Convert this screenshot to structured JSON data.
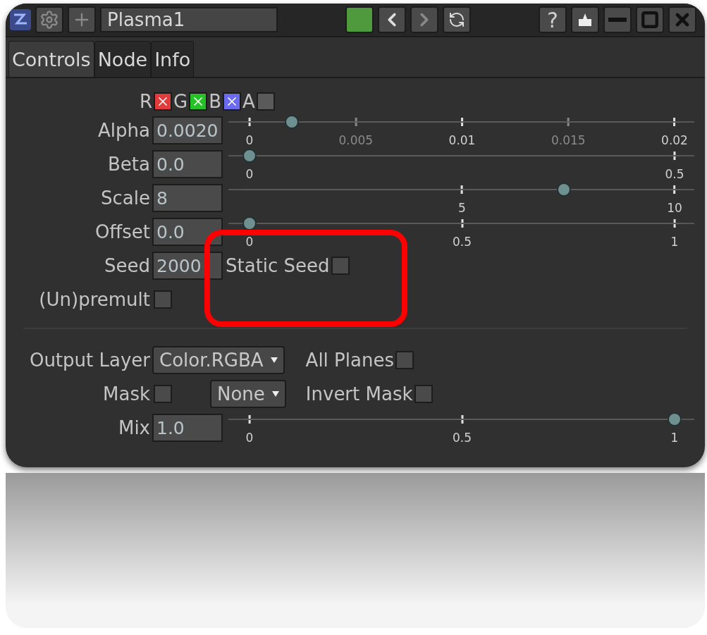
{
  "title_bar": {
    "node_name": "Plasma1",
    "help": "?"
  },
  "tabs": [
    {
      "label": "Controls",
      "selected": true
    },
    {
      "label": "Node",
      "selected": false
    },
    {
      "label": "Info",
      "selected": false
    }
  ],
  "channels": [
    {
      "label": "R",
      "checked": true,
      "color": "#e23b3b"
    },
    {
      "label": "G",
      "checked": true,
      "color": "#26c126"
    },
    {
      "label": "B",
      "checked": true,
      "color": "#6b6bf0"
    },
    {
      "label": "A",
      "checked": false,
      "color": "#5a5a5a"
    }
  ],
  "params": [
    {
      "kind": "slider",
      "label": "Alpha",
      "value": "0.0020",
      "level": 0.1,
      "ticks": [
        {
          "label": "0",
          "major": true
        },
        {
          "label": "0.005",
          "major": false
        },
        {
          "label": "0.01",
          "major": true
        },
        {
          "label": "0.015",
          "major": false
        },
        {
          "label": "0.02",
          "major": true
        }
      ]
    },
    {
      "kind": "slider",
      "label": "Beta",
      "value": "0.0",
      "level": 0,
      "ticks": [
        {
          "label": "0",
          "major": true
        },
        {
          "label": "0.5",
          "major": true
        }
      ]
    },
    {
      "kind": "slider",
      "label": "Scale",
      "value": "8",
      "level": 0.74,
      "ticks": [
        {
          "label": "5",
          "major": true
        },
        {
          "label": "10",
          "major": true
        }
      ]
    },
    {
      "kind": "slider",
      "label": "Offset",
      "value": "0.0",
      "level": 0,
      "ticks": [
        {
          "label": "0",
          "major": true
        },
        {
          "label": "0.5",
          "major": true
        },
        {
          "label": "1",
          "major": true
        }
      ]
    },
    {
      "kind": "seed",
      "label": "Seed",
      "value": "2000",
      "option": {
        "label": "Static Seed",
        "checked": false
      }
    },
    {
      "kind": "check",
      "label": "(Un)premult",
      "checked": false
    }
  ],
  "output": [
    {
      "kind": "layer",
      "label": "Output Layer",
      "dropdown": "Color.RGBA",
      "option": {
        "label": "All Planes",
        "checked": false
      }
    },
    {
      "kind": "mask",
      "label": "Mask",
      "checked": false,
      "dropdown": "None",
      "option": {
        "label": "Invert Mask",
        "checked": false
      }
    },
    {
      "kind": "slider",
      "label": "Mix",
      "value": "1.0",
      "level": 1,
      "ticks": [
        {
          "label": "0",
          "major": true
        },
        {
          "label": "0.5",
          "major": true
        },
        {
          "label": "1",
          "major": true
        }
      ]
    }
  ]
}
